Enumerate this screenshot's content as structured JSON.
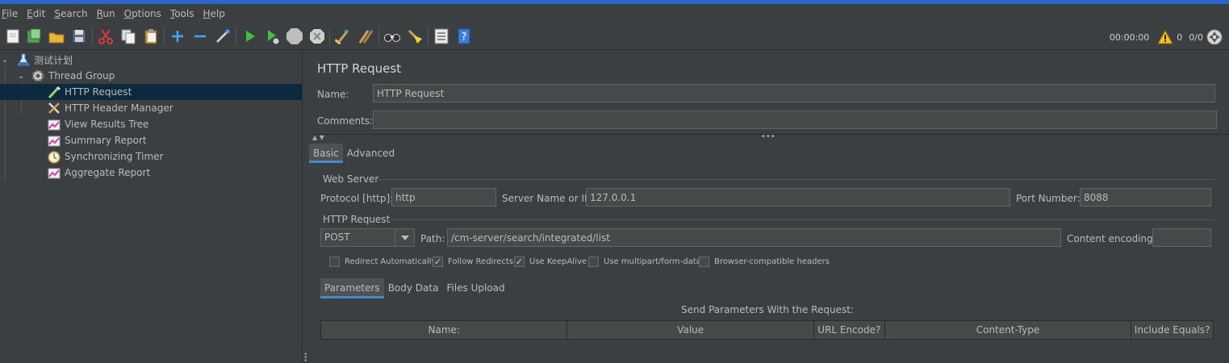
{
  "menu": [
    {
      "mnemonic": "F",
      "rest": "ile"
    },
    {
      "mnemonic": "E",
      "rest": "dit"
    },
    {
      "mnemonic": "S",
      "rest": "earch"
    },
    {
      "mnemonic": "R",
      "rest": "un"
    },
    {
      "mnemonic": "O",
      "rest": "ptions"
    },
    {
      "mnemonic": "T",
      "rest": "ools"
    },
    {
      "mnemonic": "H",
      "rest": "elp"
    }
  ],
  "toolbar": {
    "buttons": [
      "new-icon",
      "templates-icon",
      "open-icon",
      "save-icon",
      "cut-icon",
      "copy-icon",
      "paste-icon",
      "expand-icon",
      "collapse-icon",
      "toggle-icon",
      "start-icon",
      "start-no-pause-icon",
      "stop-icon",
      "shutdown-icon",
      "clear-icon",
      "clear-all-icon",
      "search-icon",
      "reset-search-icon",
      "function-helper-icon",
      "help-icon"
    ],
    "timer": "00:00:00",
    "warnings": "0",
    "threads": "0/0"
  },
  "tree": {
    "test_plan": "测试计划",
    "thread_group": "Thread Group",
    "items": [
      {
        "label": "HTTP Request",
        "icon": "pipette-icon",
        "selected": true
      },
      {
        "label": "HTTP Header Manager",
        "icon": "wrench-icon",
        "selected": false
      },
      {
        "label": "View Results Tree",
        "icon": "chart-icon",
        "selected": false
      },
      {
        "label": "Summary Report",
        "icon": "chart-icon",
        "selected": false
      },
      {
        "label": "Synchronizing Timer",
        "icon": "stopwatch-icon",
        "selected": false
      },
      {
        "label": "Aggregate Report",
        "icon": "chart-icon",
        "selected": false
      }
    ]
  },
  "panel": {
    "title": "HTTP Request",
    "name_label": "Name:",
    "name_value": "HTTP Request",
    "comments_label": "Comments:",
    "comments_value": "",
    "tabs": [
      "Basic",
      "Advanced"
    ],
    "web_server": {
      "title": "Web Server",
      "protocol_label": "Protocol [http]:",
      "protocol_value": "http",
      "server_label": "Server Name or IP:",
      "server_value": "127.0.0.1",
      "port_label": "Port Number:",
      "port_value": "8088"
    },
    "http_request": {
      "title": "HTTP Request",
      "method": "POST",
      "path_label": "Path:",
      "path_value": "/cm-server/search/integrated/list",
      "encoding_label": "Content encoding:",
      "encoding_value": ""
    },
    "options": [
      {
        "label": "Redirect Automatically",
        "checked": false
      },
      {
        "label": "Follow Redirects",
        "checked": true
      },
      {
        "label": "Use KeepAlive",
        "checked": true
      },
      {
        "label": "Use multipart/form-data",
        "checked": false
      },
      {
        "label": "Browser-compatible headers",
        "checked": false
      }
    ],
    "subtabs": [
      "Parameters",
      "Body Data",
      "Files Upload"
    ],
    "params_title": "Send Parameters With the Request:",
    "columns": [
      "Name:",
      "Value",
      "URL Encode?",
      "Content-Type",
      "Include Equals?"
    ]
  },
  "colors": {
    "background": "#3c3f41",
    "selection": "#0d293e",
    "accent": "#4a88c7",
    "title_strip": "#2f65ca"
  }
}
